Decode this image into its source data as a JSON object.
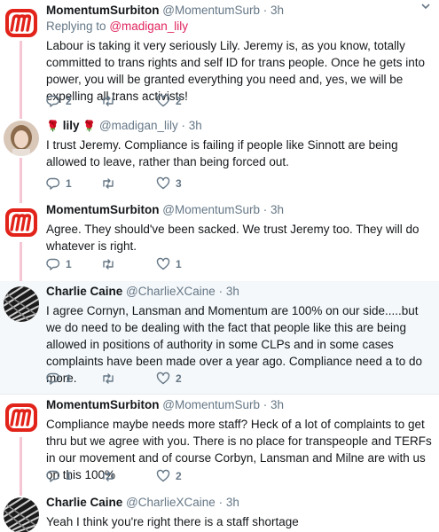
{
  "thread": {
    "tweets": [
      {
        "name": "MomentumSurbiton",
        "handle": "@MomentumSurb",
        "dot": "·",
        "time": "3h",
        "reply_prefix": "Replying to",
        "reply_to": "@madigan_lily",
        "text": "Labour is taking it very seriously Lily. Jeremy is, as you know, totally committed to trans rights and self ID for trans people. Once he gets into power, you will be granted everything you need and, yes, we will be expelling all trans activists!",
        "replies": "2",
        "retweets": "",
        "likes": "2"
      },
      {
        "name": "lily",
        "rose_left": "🌹",
        "rose_right": "🌹",
        "handle": "@madigan_lily",
        "dot": "·",
        "time": "3h",
        "text": "I trust Jeremy. Compliance is failing if people like Sinnott are being allowed to leave, rather than being forced out.",
        "replies": "1",
        "retweets": "",
        "likes": "3"
      },
      {
        "name": "MomentumSurbiton",
        "handle": "@MomentumSurb",
        "dot": "·",
        "time": "3h",
        "text": "Agree. They should've been sacked. We trust Jeremy too. They will do whatever is right.",
        "replies": "1",
        "retweets": "",
        "likes": "1"
      },
      {
        "name": "Charlie Caine",
        "handle": "@CharlieXCaine",
        "dot": "·",
        "time": "3h",
        "text": "I agree Cornyn, Lansman and Momentum are 100% on our side.....but we do need to be dealing with the fact that people like this are being allowed in positions of authority in some CLPs and in some cases complaints have been made over a year ago. Compliance need a to do more.",
        "replies": "1",
        "retweets": "",
        "likes": "2"
      },
      {
        "name": "MomentumSurbiton",
        "handle": "@MomentumSurb",
        "dot": "·",
        "time": "3h",
        "text": "Compliance maybe needs more staff? Heck of a lot of complaints to get thru but we agree with you. There is no place for transpeople and TERFs in our movement and of course Corbyn, Lansman and Milne are with us on this 100%",
        "replies": "1",
        "retweets": "",
        "likes": "2"
      },
      {
        "name": "Charlie Caine",
        "handle": "@CharlieXCaine",
        "dot": "·",
        "time": "3h",
        "text": "Yeah I think you're right there is a staff shortage",
        "replies": "",
        "retweets": "",
        "likes": ""
      }
    ]
  },
  "icons": {
    "reply": "reply-icon",
    "retweet": "retweet-icon",
    "like": "heart-icon",
    "more": "chevron-down-icon"
  },
  "colors": {
    "momentum_red": "#e2231a",
    "thread_line": "#f7c6d4",
    "mention": "#e0245e",
    "highlight_bg": "#f5f8fa",
    "muted": "#657786"
  }
}
